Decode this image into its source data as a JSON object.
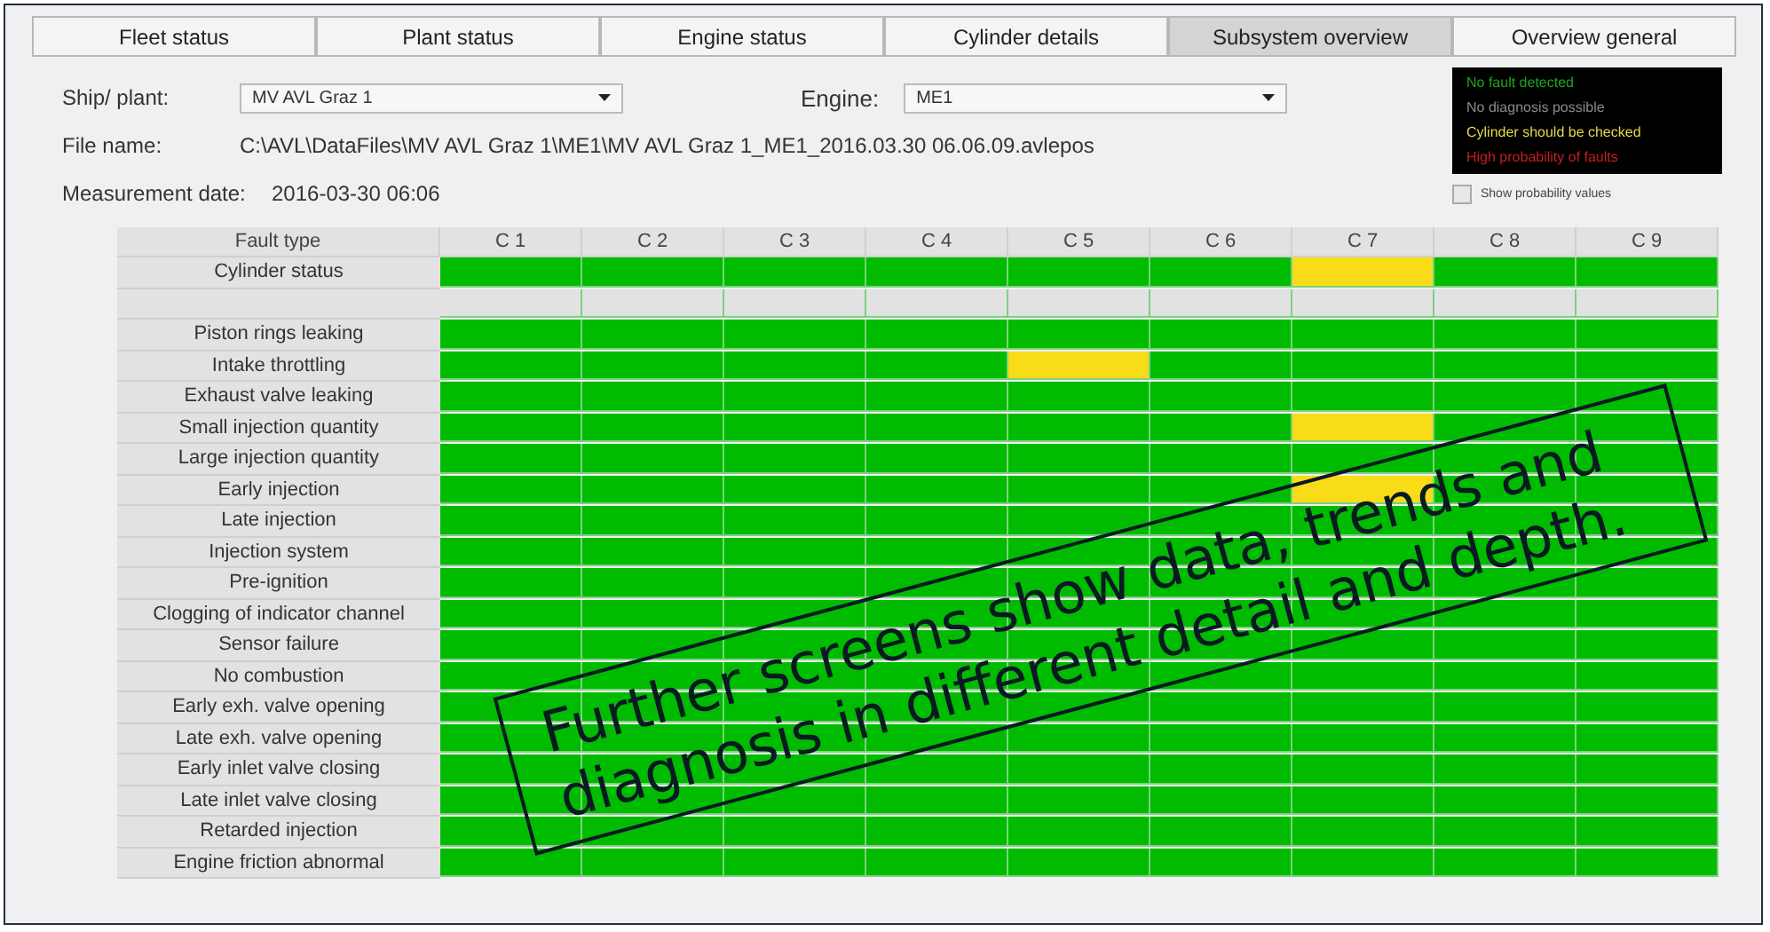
{
  "tabs": [
    {
      "label": "Fleet status",
      "selected": false
    },
    {
      "label": "Plant status",
      "selected": false
    },
    {
      "label": "Engine status",
      "selected": false
    },
    {
      "label": "Cylinder details",
      "selected": false
    },
    {
      "label": "Subsystem overview",
      "selected": true
    },
    {
      "label": "Overview general",
      "selected": false
    }
  ],
  "ship_plant": {
    "label": "Ship/ plant:",
    "value": "MV AVL Graz 1"
  },
  "engine": {
    "label": "Engine:",
    "value": "ME1"
  },
  "file_name": {
    "label": "File name:",
    "value": "C:\\AVL\\DataFiles\\MV AVL Graz 1\\ME1\\MV AVL Graz 1_ME1_2016.03.30 06.06.09.avlepos"
  },
  "measurement_date": {
    "label": "Measurement date:",
    "value": "2016-03-30 06:06"
  },
  "legend": [
    {
      "label": "No fault detected",
      "color": "#1fa51f"
    },
    {
      "label": "No diagnosis possible",
      "color": "#8a8a8a"
    },
    {
      "label": "Cylinder should be checked",
      "color": "#e6d84a"
    },
    {
      "label": "High probability of faults",
      "color": "#c81e1e"
    }
  ],
  "show_probability": {
    "label": "Show probability values",
    "checked": false
  },
  "table": {
    "columns": [
      "Fault type",
      "C 1",
      "C 2",
      "C 3",
      "C 4",
      "C 5",
      "C 6",
      "C 7",
      "C 8",
      "C 9"
    ],
    "rows": [
      {
        "label": "Cylinder status",
        "cells": [
          {
            "color": "#00bb00"
          },
          {
            "color": "#00bb00"
          },
          {
            "color": "#00bb00"
          },
          {
            "color": "#00bb00"
          },
          {
            "color": "#00bb00"
          },
          {
            "color": "#00bb00"
          },
          {
            "color": "#f8dc18"
          },
          {
            "color": "#00bb00"
          },
          {
            "color": "#00bb00"
          }
        ]
      },
      {
        "cells": [
          {
            "color": "#e2e2e2"
          },
          {
            "color": "#e2e2e2"
          },
          {
            "color": "#e2e2e2"
          },
          {
            "color": "#e2e2e2"
          },
          {
            "color": "#e2e2e2"
          },
          {
            "color": "#e2e2e2"
          },
          {
            "color": "#e2e2e2"
          },
          {
            "color": "#e2e2e2"
          },
          {
            "color": "#e2e2e2"
          }
        ]
      },
      {
        "label": "Piston rings leaking",
        "cells": [
          {
            "color": "#00bb00"
          },
          {
            "color": "#00bb00"
          },
          {
            "color": "#00bb00"
          },
          {
            "color": "#00bb00"
          },
          {
            "color": "#00bb00"
          },
          {
            "color": "#00bb00"
          },
          {
            "color": "#00bb00"
          },
          {
            "color": "#00bb00"
          },
          {
            "color": "#00bb00"
          }
        ]
      },
      {
        "label": "Intake throttling",
        "cells": [
          {
            "color": "#00bb00"
          },
          {
            "color": "#00bb00"
          },
          {
            "color": "#00bb00"
          },
          {
            "color": "#00bb00"
          },
          {
            "color": "#f8dc18"
          },
          {
            "color": "#00bb00"
          },
          {
            "color": "#00bb00"
          },
          {
            "color": "#00bb00"
          },
          {
            "color": "#00bb00"
          }
        ]
      },
      {
        "label": "Exhaust valve leaking",
        "cells": [
          {
            "color": "#00bb00"
          },
          {
            "color": "#00bb00"
          },
          {
            "color": "#00bb00"
          },
          {
            "color": "#00bb00"
          },
          {
            "color": "#00bb00"
          },
          {
            "color": "#00bb00"
          },
          {
            "color": "#00bb00"
          },
          {
            "color": "#00bb00"
          },
          {
            "color": "#00bb00"
          }
        ]
      },
      {
        "label": "Small injection quantity",
        "cells": [
          {
            "color": "#00bb00"
          },
          {
            "color": "#00bb00"
          },
          {
            "color": "#00bb00"
          },
          {
            "color": "#00bb00"
          },
          {
            "color": "#00bb00"
          },
          {
            "color": "#00bb00"
          },
          {
            "color": "#f8dc18"
          },
          {
            "color": "#00bb00"
          },
          {
            "color": "#00bb00"
          }
        ]
      },
      {
        "label": "Large injection quantity",
        "cells": [
          {
            "color": "#00bb00"
          },
          {
            "color": "#00bb00"
          },
          {
            "color": "#00bb00"
          },
          {
            "color": "#00bb00"
          },
          {
            "color": "#00bb00"
          },
          {
            "color": "#00bb00"
          },
          {
            "color": "#00bb00"
          },
          {
            "color": "#00bb00"
          },
          {
            "color": "#00bb00"
          }
        ]
      },
      {
        "label": "Early injection",
        "cells": [
          {
            "color": "#00bb00"
          },
          {
            "color": "#00bb00"
          },
          {
            "color": "#00bb00"
          },
          {
            "color": "#00bb00"
          },
          {
            "color": "#00bb00"
          },
          {
            "color": "#00bb00"
          },
          {
            "color": "#f8dc18"
          },
          {
            "color": "#00bb00"
          },
          {
            "color": "#00bb00"
          }
        ]
      },
      {
        "label": "Late injection",
        "cells": [
          {
            "color": "#00bb00"
          },
          {
            "color": "#00bb00"
          },
          {
            "color": "#00bb00"
          },
          {
            "color": "#00bb00"
          },
          {
            "color": "#00bb00"
          },
          {
            "color": "#00bb00"
          },
          {
            "color": "#00bb00"
          },
          {
            "color": "#00bb00"
          },
          {
            "color": "#00bb00"
          }
        ]
      },
      {
        "label": "Injection system",
        "cells": [
          {
            "color": "#00bb00"
          },
          {
            "color": "#00bb00"
          },
          {
            "color": "#00bb00"
          },
          {
            "color": "#00bb00"
          },
          {
            "color": "#00bb00"
          },
          {
            "color": "#00bb00"
          },
          {
            "color": "#00bb00"
          },
          {
            "color": "#00bb00"
          },
          {
            "color": "#00bb00"
          }
        ]
      },
      {
        "label": "Pre-ignition",
        "cells": [
          {
            "color": "#00bb00"
          },
          {
            "color": "#00bb00"
          },
          {
            "color": "#00bb00"
          },
          {
            "color": "#00bb00"
          },
          {
            "color": "#00bb00"
          },
          {
            "color": "#00bb00"
          },
          {
            "color": "#00bb00"
          },
          {
            "color": "#00bb00"
          },
          {
            "color": "#00bb00"
          }
        ]
      },
      {
        "label": "Clogging of indicator channel",
        "cells": [
          {
            "color": "#00bb00"
          },
          {
            "color": "#00bb00"
          },
          {
            "color": "#00bb00"
          },
          {
            "color": "#00bb00"
          },
          {
            "color": "#00bb00"
          },
          {
            "color": "#00bb00"
          },
          {
            "color": "#00bb00"
          },
          {
            "color": "#00bb00"
          },
          {
            "color": "#00bb00"
          }
        ]
      },
      {
        "label": "Sensor failure",
        "cells": [
          {
            "color": "#00bb00"
          },
          {
            "color": "#00bb00"
          },
          {
            "color": "#00bb00"
          },
          {
            "color": "#00bb00"
          },
          {
            "color": "#00bb00"
          },
          {
            "color": "#00bb00"
          },
          {
            "color": "#00bb00"
          },
          {
            "color": "#00bb00"
          },
          {
            "color": "#00bb00"
          }
        ]
      },
      {
        "label": "No combustion",
        "cells": [
          {
            "color": "#00bb00"
          },
          {
            "color": "#00bb00"
          },
          {
            "color": "#00bb00"
          },
          {
            "color": "#00bb00"
          },
          {
            "color": "#00bb00"
          },
          {
            "color": "#00bb00"
          },
          {
            "color": "#00bb00"
          },
          {
            "color": "#00bb00"
          },
          {
            "color": "#00bb00"
          }
        ]
      },
      {
        "label": "Early exh. valve opening",
        "cells": [
          {
            "color": "#00bb00"
          },
          {
            "color": "#00bb00"
          },
          {
            "color": "#00bb00"
          },
          {
            "color": "#00bb00"
          },
          {
            "color": "#00bb00"
          },
          {
            "color": "#00bb00"
          },
          {
            "color": "#00bb00"
          },
          {
            "color": "#00bb00"
          },
          {
            "color": "#00bb00"
          }
        ]
      },
      {
        "label": "Late exh. valve opening",
        "cells": [
          {
            "color": "#00bb00"
          },
          {
            "color": "#00bb00"
          },
          {
            "color": "#00bb00"
          },
          {
            "color": "#00bb00"
          },
          {
            "color": "#00bb00"
          },
          {
            "color": "#00bb00"
          },
          {
            "color": "#00bb00"
          },
          {
            "color": "#00bb00"
          },
          {
            "color": "#00bb00"
          }
        ]
      },
      {
        "label": "Early inlet valve closing",
        "cells": [
          {
            "color": "#00bb00"
          },
          {
            "color": "#00bb00"
          },
          {
            "color": "#00bb00"
          },
          {
            "color": "#00bb00"
          },
          {
            "color": "#00bb00"
          },
          {
            "color": "#00bb00"
          },
          {
            "color": "#00bb00"
          },
          {
            "color": "#00bb00"
          },
          {
            "color": "#00bb00"
          }
        ]
      },
      {
        "label": "Late inlet valve closing",
        "cells": [
          {
            "color": "#00bb00"
          },
          {
            "color": "#00bb00"
          },
          {
            "color": "#00bb00"
          },
          {
            "color": "#00bb00"
          },
          {
            "color": "#00bb00"
          },
          {
            "color": "#00bb00"
          },
          {
            "color": "#00bb00"
          },
          {
            "color": "#00bb00"
          },
          {
            "color": "#00bb00"
          }
        ]
      },
      {
        "label": "Retarded injection",
        "cells": [
          {
            "color": "#00bb00"
          },
          {
            "color": "#00bb00"
          },
          {
            "color": "#00bb00"
          },
          {
            "color": "#00bb00"
          },
          {
            "color": "#00bb00"
          },
          {
            "color": "#00bb00"
          },
          {
            "color": "#00bb00"
          },
          {
            "color": "#00bb00"
          },
          {
            "color": "#00bb00"
          }
        ]
      },
      {
        "label": "Engine friction abnormal",
        "cells": [
          {
            "color": "#00bb00"
          },
          {
            "color": "#00bb00"
          },
          {
            "color": "#00bb00"
          },
          {
            "color": "#00bb00"
          },
          {
            "color": "#00bb00"
          },
          {
            "color": "#00bb00"
          },
          {
            "color": "#00bb00"
          },
          {
            "color": "#00bb00"
          },
          {
            "color": "#00bb00"
          }
        ]
      }
    ]
  },
  "callout": {
    "text": "Further screens show data, trends and diagnosis in different detail and depth."
  }
}
